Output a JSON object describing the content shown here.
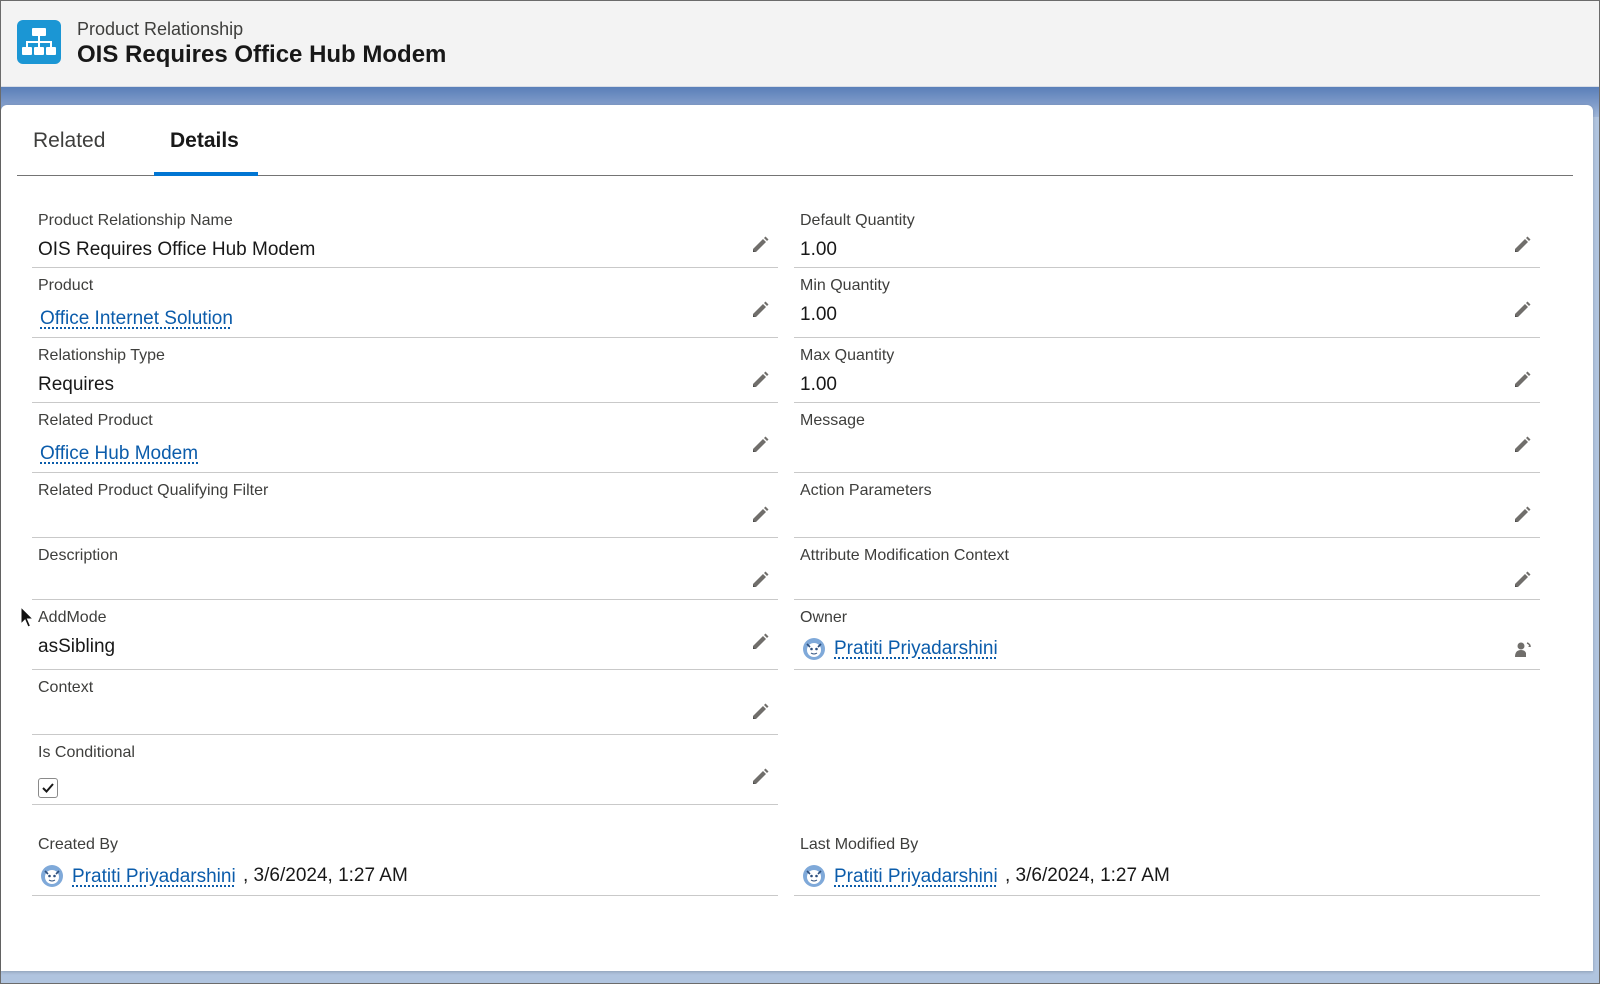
{
  "header": {
    "object_type": "Product Relationship",
    "record_title": "OIS Requires Office Hub Modem"
  },
  "tabs": [
    {
      "label": "Related",
      "active": false
    },
    {
      "label": "Details",
      "active": true
    }
  ],
  "left_fields": [
    {
      "label": "Product Relationship Name",
      "value": "OIS Requires Office Hub Modem",
      "type": "text"
    },
    {
      "label": "Product",
      "value": "Office Internet Solution",
      "type": "link"
    },
    {
      "label": "Relationship Type",
      "value": "Requires",
      "type": "text"
    },
    {
      "label": "Related Product",
      "value": "Office Hub Modem",
      "type": "link"
    },
    {
      "label": "Related Product Qualifying Filter",
      "value": "",
      "type": "text"
    },
    {
      "label": "Description",
      "value": "",
      "type": "text"
    },
    {
      "label": "AddMode",
      "value": "asSibling",
      "type": "text"
    },
    {
      "label": "Context",
      "value": "",
      "type": "text"
    },
    {
      "label": "Is Conditional",
      "value": "",
      "type": "checkbox",
      "checked": true
    }
  ],
  "right_fields": [
    {
      "label": "Default Quantity",
      "value": "1.00",
      "type": "text"
    },
    {
      "label": "Min Quantity",
      "value": "1.00",
      "type": "text"
    },
    {
      "label": "Max Quantity",
      "value": "1.00",
      "type": "text"
    },
    {
      "label": "Message",
      "value": "",
      "type": "text"
    },
    {
      "label": "Action Parameters",
      "value": "",
      "type": "text"
    },
    {
      "label": "Attribute Modification Context",
      "value": "",
      "type": "text"
    },
    {
      "label": "Owner",
      "value": "Pratiti Priyadarshini",
      "type": "user"
    }
  ],
  "audit": {
    "created_by": {
      "label": "Created By",
      "user": "Pratiti Priyadarshini",
      "timestamp": ", 3/6/2024, 1:27 AM"
    },
    "last_modified_by": {
      "label": "Last Modified By",
      "user": "Pratiti Priyadarshini",
      "timestamp": ", 3/6/2024, 1:27 AM"
    }
  },
  "colors": {
    "accent": "#0176d3",
    "link": "#0b5cab",
    "icon_bg": "#1b96d4",
    "band": "#5a7fb8"
  }
}
